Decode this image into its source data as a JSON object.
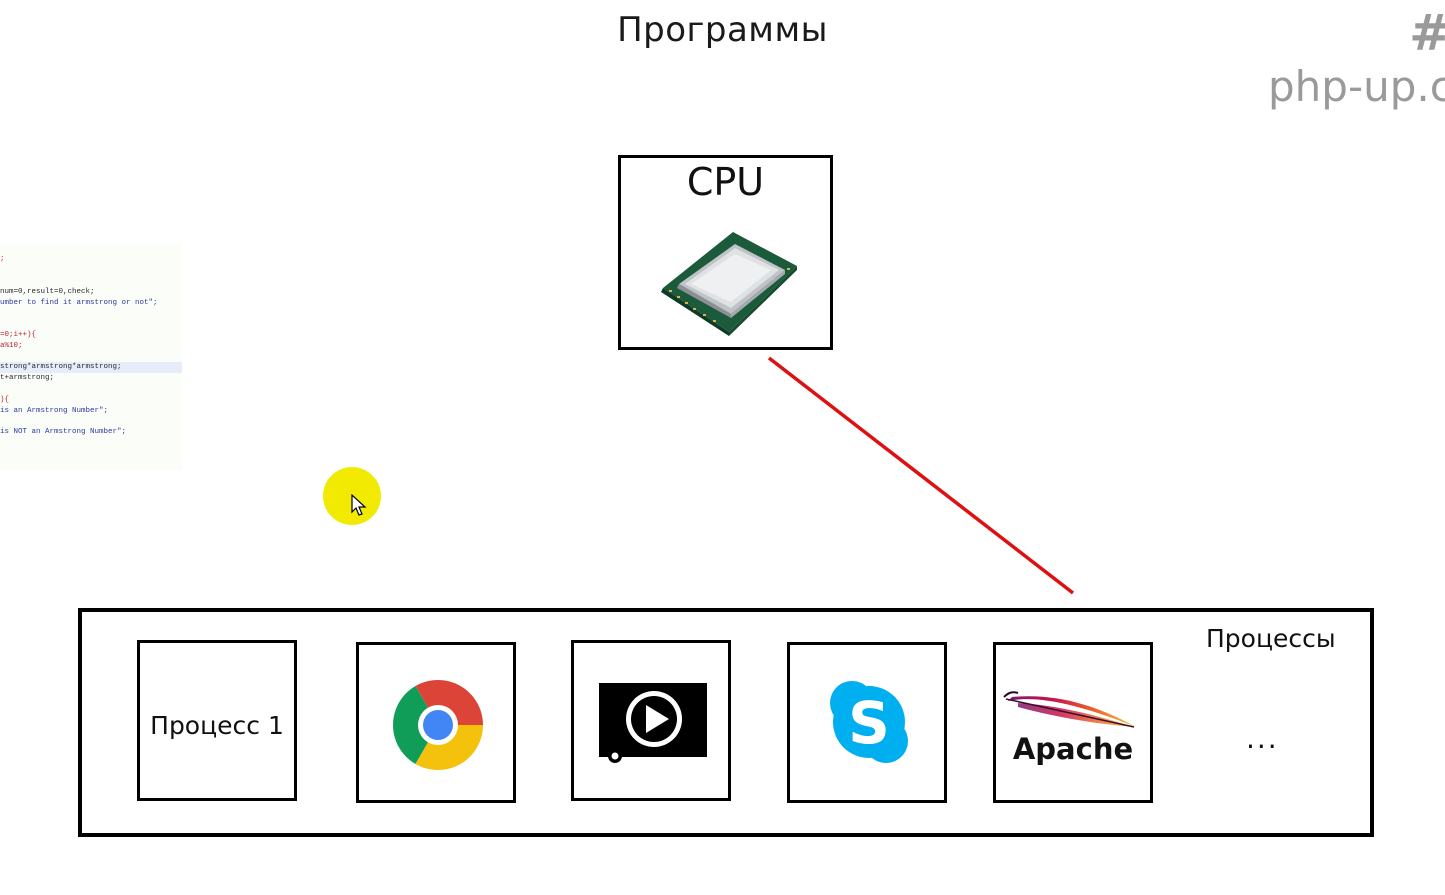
{
  "title": "Программы",
  "watermark": {
    "hash": "#",
    "site": "php-up.c"
  },
  "code_snippet": {
    "lines": [
      {
        "text": ";",
        "cls": "c-red"
      },
      {
        "text": "num=0,result=0,check;",
        "cls": "c-dark"
      },
      {
        "text": "umber to find it armstrong or not\";",
        "cls": "c-blue"
      },
      {
        "text": "=0;i++){",
        "cls": "c-red"
      },
      {
        "text": "a%10;",
        "cls": "c-red"
      },
      {
        "text": "strong*armstrong*armstrong;",
        "cls": "c-dark"
      },
      {
        "text": "t+armstrong;",
        "cls": "c-dark"
      },
      {
        "text": "){",
        "cls": "c-red"
      },
      {
        "text": "is an Armstrong Number\";",
        "cls": "c-blue"
      },
      {
        "text": "is NOT an Armstrong Number\";",
        "cls": "c-blue"
      }
    ]
  },
  "cpu": {
    "label": "CPU",
    "image": "cpu-chip"
  },
  "processes": {
    "label": "Процессы",
    "items": [
      {
        "kind": "text",
        "label": "Процесс 1"
      },
      {
        "kind": "icon",
        "icon": "chrome-icon"
      },
      {
        "kind": "icon",
        "icon": "video-player-icon"
      },
      {
        "kind": "icon",
        "icon": "skype-icon"
      },
      {
        "kind": "icon",
        "icon": "apache-feather-icon",
        "label": "Apache"
      }
    ],
    "more": "..."
  },
  "colors": {
    "connector": "#dd1111",
    "cursor_highlight": "#f2ea00",
    "chrome_red": "#db4437",
    "chrome_green": "#0f9d58",
    "chrome_yellow": "#f4c20d",
    "chrome_blue": "#4285f4",
    "skype_blue": "#00aff0"
  }
}
